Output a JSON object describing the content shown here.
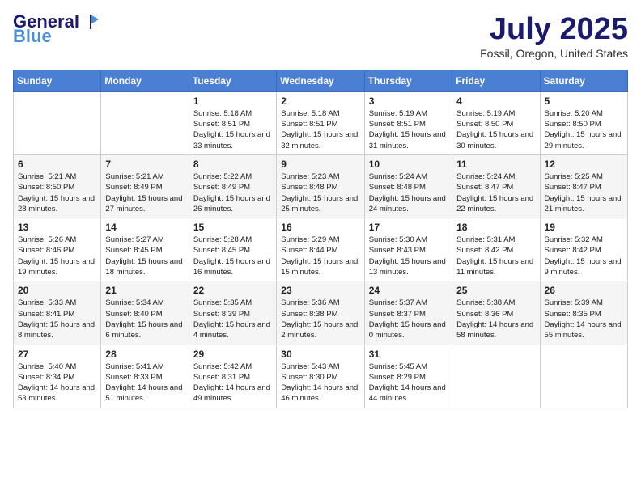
{
  "header": {
    "logo_general": "General",
    "logo_blue": "Blue",
    "month_title": "July 2025",
    "subtitle": "Fossil, Oregon, United States"
  },
  "days_of_week": [
    "Sunday",
    "Monday",
    "Tuesday",
    "Wednesday",
    "Thursday",
    "Friday",
    "Saturday"
  ],
  "weeks": [
    [
      {
        "day": "",
        "sunrise": "",
        "sunset": "",
        "daylight": ""
      },
      {
        "day": "",
        "sunrise": "",
        "sunset": "",
        "daylight": ""
      },
      {
        "day": "1",
        "sunrise": "Sunrise: 5:18 AM",
        "sunset": "Sunset: 8:51 PM",
        "daylight": "Daylight: 15 hours and 33 minutes."
      },
      {
        "day": "2",
        "sunrise": "Sunrise: 5:18 AM",
        "sunset": "Sunset: 8:51 PM",
        "daylight": "Daylight: 15 hours and 32 minutes."
      },
      {
        "day": "3",
        "sunrise": "Sunrise: 5:19 AM",
        "sunset": "Sunset: 8:51 PM",
        "daylight": "Daylight: 15 hours and 31 minutes."
      },
      {
        "day": "4",
        "sunrise": "Sunrise: 5:19 AM",
        "sunset": "Sunset: 8:50 PM",
        "daylight": "Daylight: 15 hours and 30 minutes."
      },
      {
        "day": "5",
        "sunrise": "Sunrise: 5:20 AM",
        "sunset": "Sunset: 8:50 PM",
        "daylight": "Daylight: 15 hours and 29 minutes."
      }
    ],
    [
      {
        "day": "6",
        "sunrise": "Sunrise: 5:21 AM",
        "sunset": "Sunset: 8:50 PM",
        "daylight": "Daylight: 15 hours and 28 minutes."
      },
      {
        "day": "7",
        "sunrise": "Sunrise: 5:21 AM",
        "sunset": "Sunset: 8:49 PM",
        "daylight": "Daylight: 15 hours and 27 minutes."
      },
      {
        "day": "8",
        "sunrise": "Sunrise: 5:22 AM",
        "sunset": "Sunset: 8:49 PM",
        "daylight": "Daylight: 15 hours and 26 minutes."
      },
      {
        "day": "9",
        "sunrise": "Sunrise: 5:23 AM",
        "sunset": "Sunset: 8:48 PM",
        "daylight": "Daylight: 15 hours and 25 minutes."
      },
      {
        "day": "10",
        "sunrise": "Sunrise: 5:24 AM",
        "sunset": "Sunset: 8:48 PM",
        "daylight": "Daylight: 15 hours and 24 minutes."
      },
      {
        "day": "11",
        "sunrise": "Sunrise: 5:24 AM",
        "sunset": "Sunset: 8:47 PM",
        "daylight": "Daylight: 15 hours and 22 minutes."
      },
      {
        "day": "12",
        "sunrise": "Sunrise: 5:25 AM",
        "sunset": "Sunset: 8:47 PM",
        "daylight": "Daylight: 15 hours and 21 minutes."
      }
    ],
    [
      {
        "day": "13",
        "sunrise": "Sunrise: 5:26 AM",
        "sunset": "Sunset: 8:46 PM",
        "daylight": "Daylight: 15 hours and 19 minutes."
      },
      {
        "day": "14",
        "sunrise": "Sunrise: 5:27 AM",
        "sunset": "Sunset: 8:45 PM",
        "daylight": "Daylight: 15 hours and 18 minutes."
      },
      {
        "day": "15",
        "sunrise": "Sunrise: 5:28 AM",
        "sunset": "Sunset: 8:45 PM",
        "daylight": "Daylight: 15 hours and 16 minutes."
      },
      {
        "day": "16",
        "sunrise": "Sunrise: 5:29 AM",
        "sunset": "Sunset: 8:44 PM",
        "daylight": "Daylight: 15 hours and 15 minutes."
      },
      {
        "day": "17",
        "sunrise": "Sunrise: 5:30 AM",
        "sunset": "Sunset: 8:43 PM",
        "daylight": "Daylight: 15 hours and 13 minutes."
      },
      {
        "day": "18",
        "sunrise": "Sunrise: 5:31 AM",
        "sunset": "Sunset: 8:42 PM",
        "daylight": "Daylight: 15 hours and 11 minutes."
      },
      {
        "day": "19",
        "sunrise": "Sunrise: 5:32 AM",
        "sunset": "Sunset: 8:42 PM",
        "daylight": "Daylight: 15 hours and 9 minutes."
      }
    ],
    [
      {
        "day": "20",
        "sunrise": "Sunrise: 5:33 AM",
        "sunset": "Sunset: 8:41 PM",
        "daylight": "Daylight: 15 hours and 8 minutes."
      },
      {
        "day": "21",
        "sunrise": "Sunrise: 5:34 AM",
        "sunset": "Sunset: 8:40 PM",
        "daylight": "Daylight: 15 hours and 6 minutes."
      },
      {
        "day": "22",
        "sunrise": "Sunrise: 5:35 AM",
        "sunset": "Sunset: 8:39 PM",
        "daylight": "Daylight: 15 hours and 4 minutes."
      },
      {
        "day": "23",
        "sunrise": "Sunrise: 5:36 AM",
        "sunset": "Sunset: 8:38 PM",
        "daylight": "Daylight: 15 hours and 2 minutes."
      },
      {
        "day": "24",
        "sunrise": "Sunrise: 5:37 AM",
        "sunset": "Sunset: 8:37 PM",
        "daylight": "Daylight: 15 hours and 0 minutes."
      },
      {
        "day": "25",
        "sunrise": "Sunrise: 5:38 AM",
        "sunset": "Sunset: 8:36 PM",
        "daylight": "Daylight: 14 hours and 58 minutes."
      },
      {
        "day": "26",
        "sunrise": "Sunrise: 5:39 AM",
        "sunset": "Sunset: 8:35 PM",
        "daylight": "Daylight: 14 hours and 55 minutes."
      }
    ],
    [
      {
        "day": "27",
        "sunrise": "Sunrise: 5:40 AM",
        "sunset": "Sunset: 8:34 PM",
        "daylight": "Daylight: 14 hours and 53 minutes."
      },
      {
        "day": "28",
        "sunrise": "Sunrise: 5:41 AM",
        "sunset": "Sunset: 8:33 PM",
        "daylight": "Daylight: 14 hours and 51 minutes."
      },
      {
        "day": "29",
        "sunrise": "Sunrise: 5:42 AM",
        "sunset": "Sunset: 8:31 PM",
        "daylight": "Daylight: 14 hours and 49 minutes."
      },
      {
        "day": "30",
        "sunrise": "Sunrise: 5:43 AM",
        "sunset": "Sunset: 8:30 PM",
        "daylight": "Daylight: 14 hours and 46 minutes."
      },
      {
        "day": "31",
        "sunrise": "Sunrise: 5:45 AM",
        "sunset": "Sunset: 8:29 PM",
        "daylight": "Daylight: 14 hours and 44 minutes."
      },
      {
        "day": "",
        "sunrise": "",
        "sunset": "",
        "daylight": ""
      },
      {
        "day": "",
        "sunrise": "",
        "sunset": "",
        "daylight": ""
      }
    ]
  ]
}
